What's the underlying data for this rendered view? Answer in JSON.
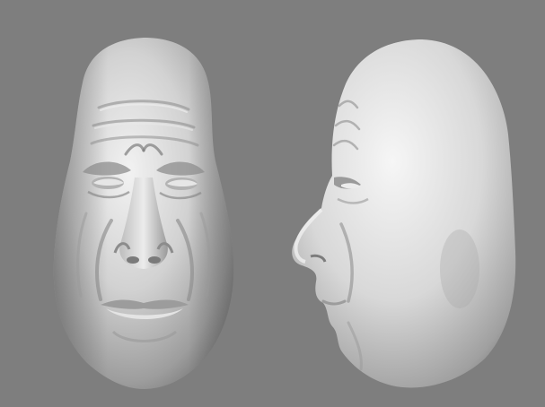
{
  "scene": {
    "background_color": "#7e7e7e",
    "surface_color": "#d9d9d9",
    "views": [
      {
        "name": "front-view",
        "subject": "sculpted-head"
      },
      {
        "name": "side-view",
        "subject": "sculpted-head"
      }
    ]
  }
}
